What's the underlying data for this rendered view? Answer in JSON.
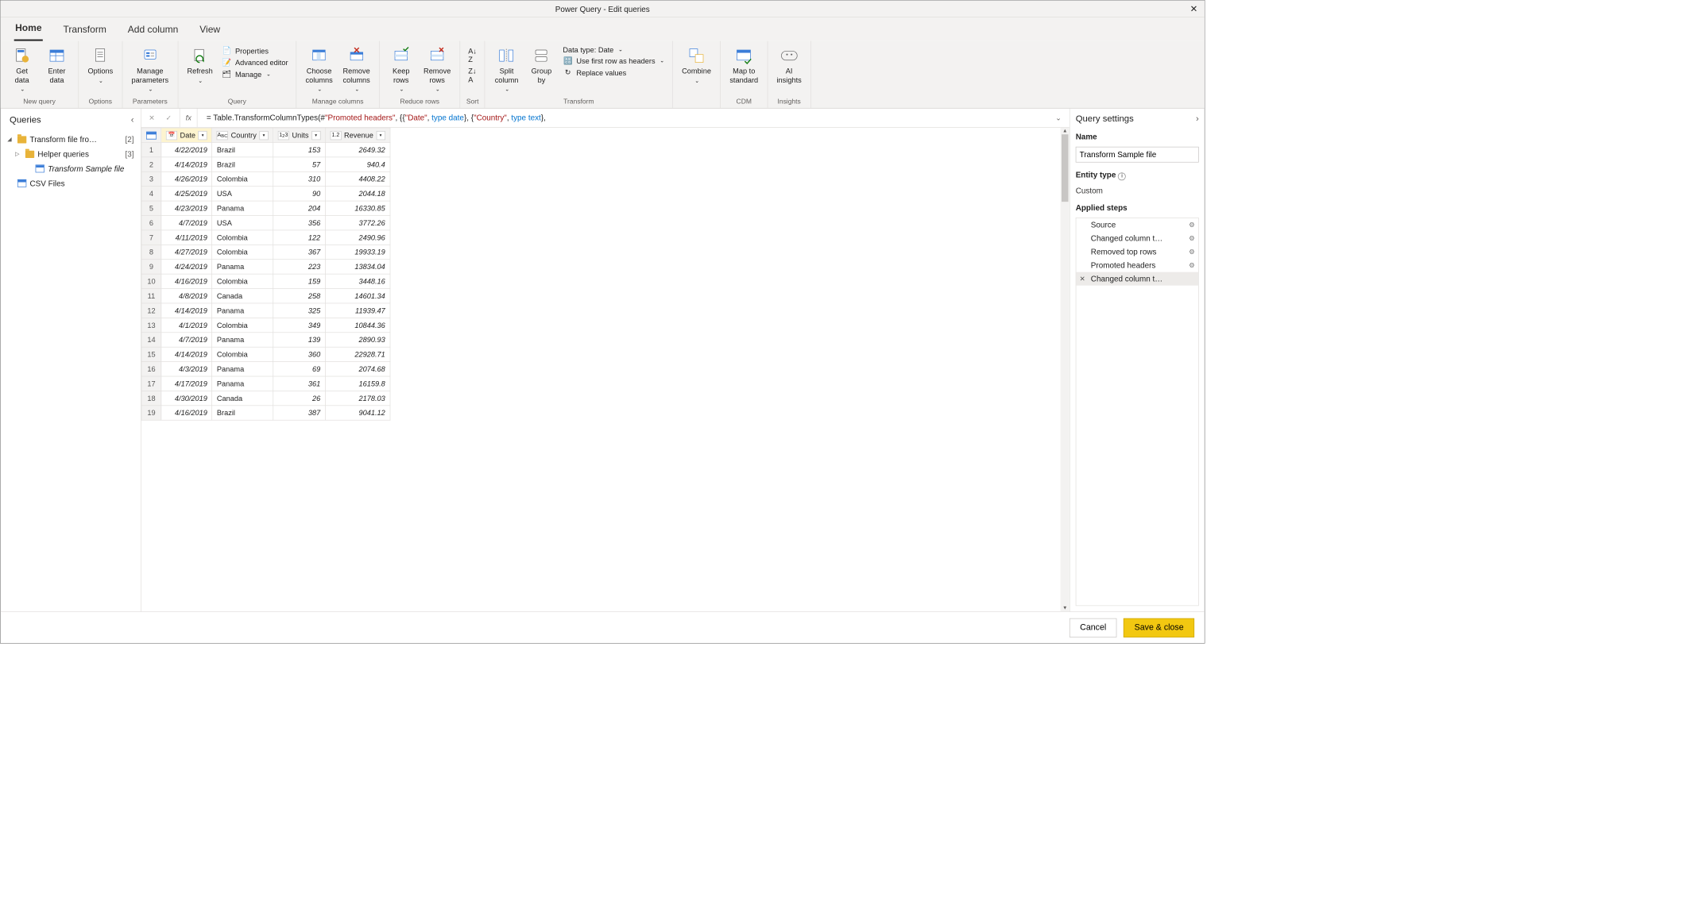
{
  "window": {
    "title": "Power Query - Edit queries"
  },
  "tabs": [
    "Home",
    "Transform",
    "Add column",
    "View"
  ],
  "active_tab": 0,
  "ribbon": {
    "new_query": {
      "label": "New query",
      "get_data": "Get\ndata",
      "enter_data": "Enter\ndata"
    },
    "options": {
      "label": "Options",
      "options": "Options"
    },
    "parameters": {
      "label": "Parameters",
      "manage": "Manage\nparameters"
    },
    "query": {
      "label": "Query",
      "refresh": "Refresh",
      "properties": "Properties",
      "advanced": "Advanced editor",
      "manage": "Manage"
    },
    "manage_cols": {
      "label": "Manage columns",
      "choose": "Choose\ncolumns",
      "remove": "Remove\ncolumns"
    },
    "reduce": {
      "label": "Reduce rows",
      "keep": "Keep\nrows",
      "remove": "Remove\nrows"
    },
    "sort": {
      "label": "Sort"
    },
    "transform": {
      "label": "Transform",
      "split": "Split\ncolumn",
      "group": "Group\nby",
      "datatype": "Data type: Date",
      "headers": "Use first row as headers",
      "replace": "Replace values"
    },
    "combine": {
      "label": "",
      "combine": "Combine"
    },
    "cdm": {
      "label": "CDM",
      "map": "Map to\nstandard"
    },
    "insights": {
      "label": "Insights",
      "ai": "AI\ninsights"
    }
  },
  "queries_panel": {
    "title": "Queries",
    "items": [
      {
        "name": "Transform file fro…",
        "count": "[2]",
        "type": "folder",
        "expanded": true
      },
      {
        "name": "Helper queries",
        "count": "[3]",
        "type": "folder",
        "expanded": false,
        "indent": 1
      },
      {
        "name": "Transform Sample file",
        "type": "table",
        "indent": 2,
        "selected": true
      },
      {
        "name": "CSV Files",
        "type": "table",
        "indent": 0
      }
    ]
  },
  "formula": {
    "prefix": "= ",
    "parts": [
      {
        "t": "Table.TransformColumnTypes(#"
      },
      {
        "t": "\"Promoted headers\"",
        "c": "str"
      },
      {
        "t": ", {{"
      },
      {
        "t": "\"Date\"",
        "c": "str"
      },
      {
        "t": ", "
      },
      {
        "t": "type date",
        "c": "kw"
      },
      {
        "t": "}, {"
      },
      {
        "t": "\"Country\"",
        "c": "str"
      },
      {
        "t": ", "
      },
      {
        "t": "type text",
        "c": "kw"
      },
      {
        "t": "},"
      }
    ]
  },
  "columns": [
    {
      "name": "Date",
      "type": "date",
      "selected": true
    },
    {
      "name": "Country",
      "type": "text"
    },
    {
      "name": "Units",
      "type": "int"
    },
    {
      "name": "Revenue",
      "type": "dec"
    }
  ],
  "rows": [
    [
      "4/22/2019",
      "Brazil",
      "153",
      "2649.32"
    ],
    [
      "4/14/2019",
      "Brazil",
      "57",
      "940.4"
    ],
    [
      "4/26/2019",
      "Colombia",
      "310",
      "4408.22"
    ],
    [
      "4/25/2019",
      "USA",
      "90",
      "2044.18"
    ],
    [
      "4/23/2019",
      "Panama",
      "204",
      "16330.85"
    ],
    [
      "4/7/2019",
      "USA",
      "356",
      "3772.26"
    ],
    [
      "4/11/2019",
      "Colombia",
      "122",
      "2490.96"
    ],
    [
      "4/27/2019",
      "Colombia",
      "367",
      "19933.19"
    ],
    [
      "4/24/2019",
      "Panama",
      "223",
      "13834.04"
    ],
    [
      "4/16/2019",
      "Colombia",
      "159",
      "3448.16"
    ],
    [
      "4/8/2019",
      "Canada",
      "258",
      "14601.34"
    ],
    [
      "4/14/2019",
      "Panama",
      "325",
      "11939.47"
    ],
    [
      "4/1/2019",
      "Colombia",
      "349",
      "10844.36"
    ],
    [
      "4/7/2019",
      "Panama",
      "139",
      "2890.93"
    ],
    [
      "4/14/2019",
      "Colombia",
      "360",
      "22928.71"
    ],
    [
      "4/3/2019",
      "Panama",
      "69",
      "2074.68"
    ],
    [
      "4/17/2019",
      "Panama",
      "361",
      "16159.8"
    ],
    [
      "4/30/2019",
      "Canada",
      "26",
      "2178.03"
    ],
    [
      "4/16/2019",
      "Brazil",
      "387",
      "9041.12"
    ]
  ],
  "settings": {
    "title": "Query settings",
    "name_label": "Name",
    "name_value": "Transform Sample file",
    "entity_label": "Entity type",
    "entity_value": "Custom",
    "steps_label": "Applied steps",
    "steps": [
      {
        "name": "Source",
        "gear": true
      },
      {
        "name": "Changed column t…",
        "gear": true
      },
      {
        "name": "Removed top rows",
        "gear": true
      },
      {
        "name": "Promoted headers",
        "gear": true
      },
      {
        "name": "Changed column t…",
        "selected": true,
        "deletable": true
      }
    ]
  },
  "footer": {
    "cancel": "Cancel",
    "save": "Save & close"
  }
}
